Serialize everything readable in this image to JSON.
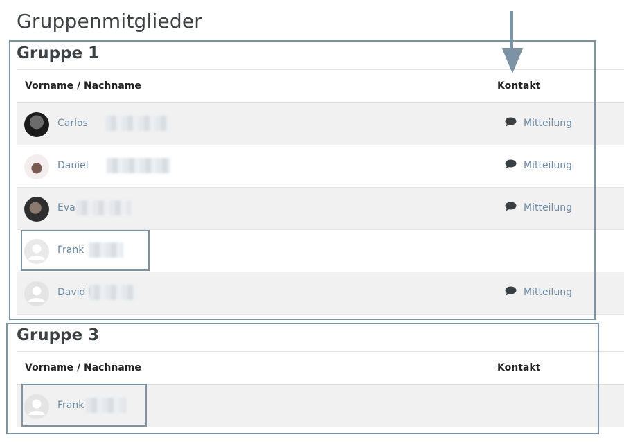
{
  "page": {
    "title": "Gruppenmitglieder"
  },
  "table_headers": {
    "name": "Vorname / Nachname",
    "contact": "Kontakt"
  },
  "groups": [
    {
      "title": "Gruppe 1",
      "members": [
        {
          "first_name": "Carlos",
          "contact_label": "Mitteilung",
          "avatar": "photo"
        },
        {
          "first_name": "Daniel",
          "contact_label": "Mitteilung",
          "avatar": "photo"
        },
        {
          "first_name": "Eva",
          "contact_label": "Mitteilung",
          "avatar": "photo"
        },
        {
          "first_name": "Frank",
          "contact_label": "",
          "avatar": "default-user-icon"
        },
        {
          "first_name": "David I",
          "contact_label": "Mitteilung",
          "avatar": "default-user-icon"
        }
      ]
    },
    {
      "title": "Gruppe 3",
      "members": [
        {
          "first_name": "Frank",
          "contact_label": "",
          "avatar": "default-user-icon"
        }
      ]
    }
  ],
  "colors": {
    "link": "#6d8aa3",
    "annotation": "#7b93a3",
    "row_shaded": "#f1f1f1"
  }
}
